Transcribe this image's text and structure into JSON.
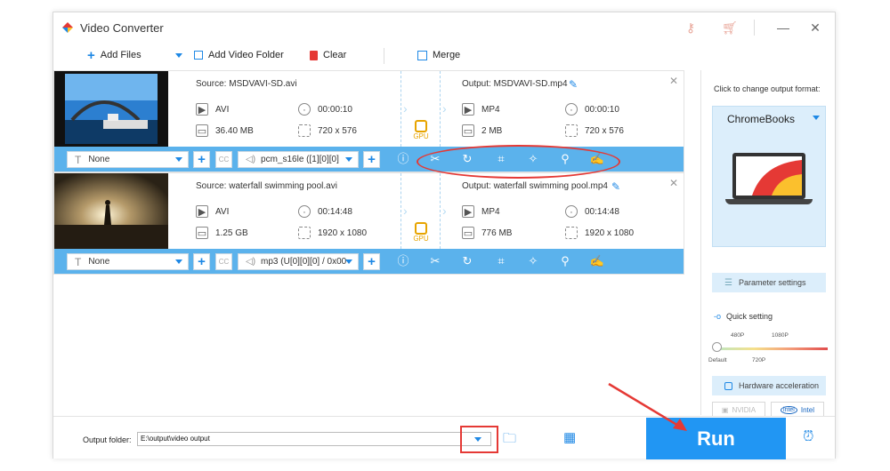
{
  "app": {
    "title": "Video Converter"
  },
  "toolbar": {
    "add_files": "Add Files",
    "add_video_folder": "Add Video Folder",
    "clear": "Clear",
    "merge": "Merge"
  },
  "items": [
    {
      "source": "Source: MSDVAVI-SD.avi",
      "output": "Output: MSDVAVI-SD.mp4",
      "src_format": "AVI",
      "src_duration": "00:00:10",
      "src_size": "36.40 MB",
      "src_resolution": "720 x 576",
      "out_format": "MP4",
      "out_duration": "00:00:10",
      "out_size": "2 MB",
      "out_resolution": "720 x 576",
      "subtitle": "None",
      "audio": "pcm_s16le ([1][0][0]",
      "gpu": "GPU"
    },
    {
      "source": "Source: waterfall swimming pool.avi",
      "output": "Output: waterfall swimming pool.mp4",
      "src_format": "AVI",
      "src_duration": "00:14:48",
      "src_size": "1.25 GB",
      "src_resolution": "1920 x 1080",
      "out_format": "MP4",
      "out_duration": "00:14:48",
      "out_size": "776 MB",
      "out_resolution": "1920 x 1080",
      "subtitle": "None",
      "audio": "mp3 (U[0][0][0] / 0x00",
      "gpu": "GPU"
    }
  ],
  "right": {
    "change_label": "Click to change output format:",
    "format": "ChromeBooks",
    "parameter_settings": "Parameter settings",
    "quick_setting": "Quick setting",
    "ticks": {
      "p480": "480P",
      "p1080": "1080P",
      "default": "Default",
      "p720": "720P"
    },
    "hardware_acceleration": "Hardware acceleration",
    "nvidia": "NVIDIA",
    "intel": "Intel"
  },
  "bottom": {
    "output_folder_label": "Output folder:",
    "output_folder_value": "E:\\output\\video output",
    "run": "Run"
  },
  "colors": {
    "accent": "#2196f3",
    "annotation": "#e53935"
  }
}
